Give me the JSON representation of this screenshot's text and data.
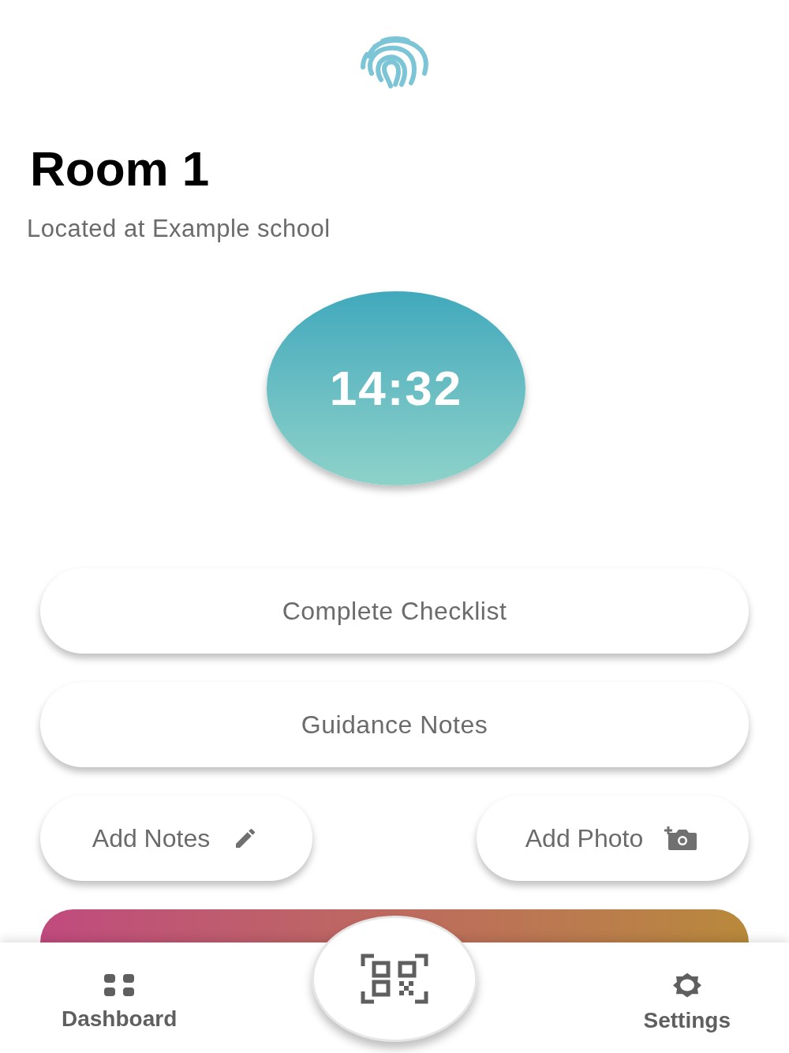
{
  "room": {
    "title": "Room 1",
    "location": "Located at Example school"
  },
  "timer": {
    "time": "14:32"
  },
  "actions": [
    {
      "label": "Complete Checklist",
      "kind": "wide"
    },
    {
      "label": "Guidance Notes",
      "kind": "wide"
    }
  ],
  "small_actions": [
    {
      "label": "Add Notes"
    },
    {
      "label": "Add Photo"
    }
  ],
  "nav": [
    {
      "label": "Dashboard",
      "kind": "tab"
    },
    {
      "kind": "center"
    },
    {
      "label": "Settings",
      "kind": "tab"
    }
  ]
}
